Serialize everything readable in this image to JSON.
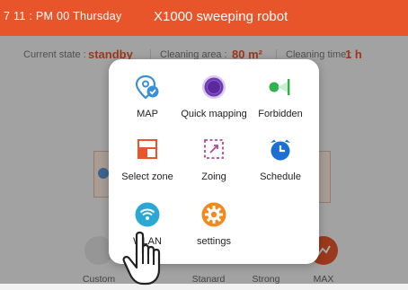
{
  "header": {
    "time": "7 11 : PM 00 Thursday",
    "title": "X1000 sweeping robot"
  },
  "status": {
    "current_state_label": "Current state :",
    "current_state_value": "standby",
    "cleaning_area_label": "Cleaning area :",
    "cleaning_area_value": "80 m²",
    "cleaning_time_label": "Cleaning time :",
    "cleaning_time_value": "1 h",
    "separator": "|"
  },
  "modes": [
    {
      "label": "Custom"
    },
    {
      "label": "Stanard"
    },
    {
      "label": "Strong"
    },
    {
      "label": "MAX"
    }
  ],
  "menu": {
    "items": [
      {
        "label": "MAP",
        "icon": "map-pin-check-icon",
        "color": "#3a8fd8"
      },
      {
        "label": "Quick mapping",
        "icon": "record-dot-icon",
        "color": "#6c3bb0"
      },
      {
        "label": "Forbidden",
        "icon": "virtual-wall-icon",
        "color": "#2fb24d"
      },
      {
        "label": "Select zone",
        "icon": "select-zone-icon",
        "color": "#e8552a"
      },
      {
        "label": "Zoing",
        "icon": "dashed-zone-icon",
        "color": "#b04a9a"
      },
      {
        "label": "Schedule",
        "icon": "alarm-clock-icon",
        "color": "#1d6fd1"
      },
      {
        "label": "WLAN",
        "icon": "wifi-icon",
        "color": "#2ba7d6"
      },
      {
        "label": "settings",
        "icon": "gear-icon",
        "color": "#f08a1d"
      }
    ]
  },
  "colors": {
    "accent": "#e8552a",
    "overlay": "rgba(0,0,0,0.33)"
  }
}
